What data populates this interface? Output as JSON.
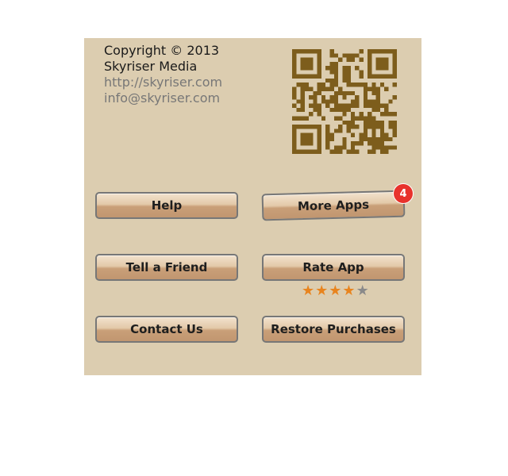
{
  "info": {
    "copyright": "Copyright © 2013",
    "company": "Skyriser Media",
    "website": "http://skyriser.com",
    "email": "info@skyriser.com"
  },
  "qr": {
    "icon": "qr-code-icon",
    "color": "#7d5d1c"
  },
  "buttons": {
    "help": "Help",
    "more_apps": "More Apps",
    "tell_friend": "Tell a Friend",
    "rate_app": "Rate App",
    "contact_us": "Contact Us",
    "restore_purchases": "Restore Purchases"
  },
  "badge": {
    "count": "4",
    "color": "#e8322c"
  },
  "rating": {
    "value": 4,
    "max": 5,
    "filled_color": "#e8841e",
    "empty_color": "#8a8a8a"
  },
  "colors": {
    "panel": "#dccdb0",
    "button_border": "#777777"
  }
}
